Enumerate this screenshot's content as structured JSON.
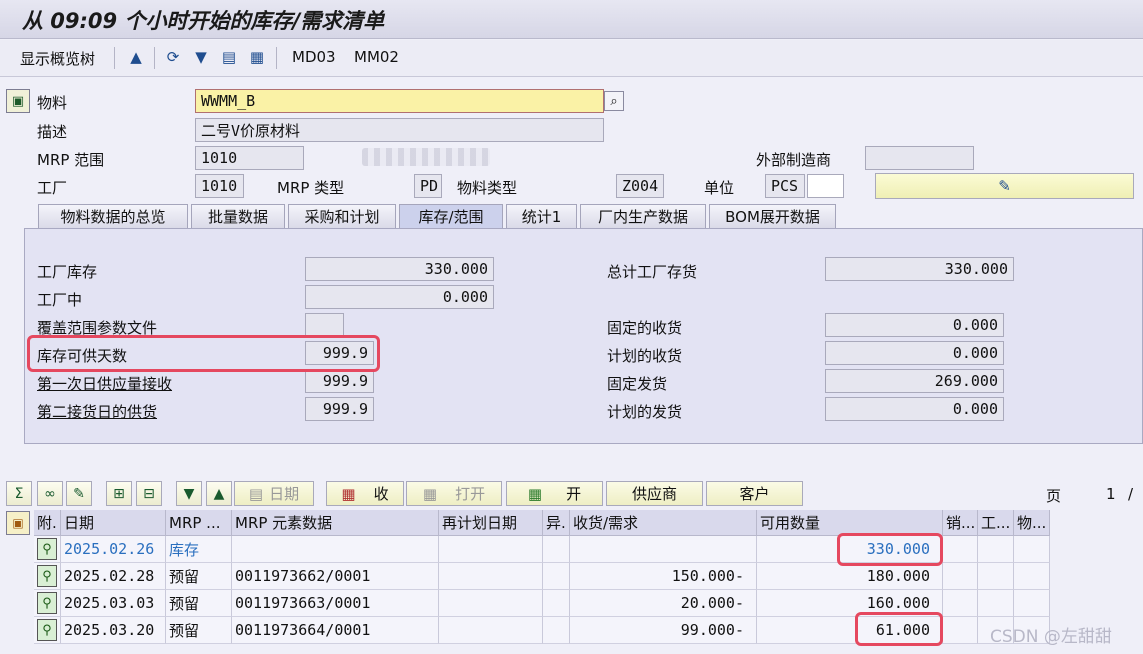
{
  "title": "从 09:09 个小时开始的库存/需求清单",
  "toolbar": {
    "show_overview_tree": "显示概览树",
    "md03": "MD03",
    "mm02": "MM02",
    "icons": [
      "overview-icon",
      "refresh-icon",
      "filter-icon",
      "save-variant-icon",
      "export-icon"
    ]
  },
  "header": {
    "material_label": "物料",
    "material_value": "WWMM_B",
    "description_label": "描述",
    "description_value": "二号V价原材料",
    "mrp_area_label": "MRP 范围",
    "mrp_area_value": "1010",
    "external_vendor_label": "外部制造商",
    "external_vendor_value": "",
    "plant_label": "工厂",
    "plant_value": "1010",
    "mrp_type_label": "MRP 类型",
    "mrp_type_value": "PD",
    "material_type_label": "物料类型",
    "material_type_value": "Z004",
    "unit_label": "单位",
    "unit_value": "PCS"
  },
  "tabs": [
    {
      "label": "物料数据的总览"
    },
    {
      "label": "批量数据"
    },
    {
      "label": "采购和计划"
    },
    {
      "label": "库存/范围",
      "active": true
    },
    {
      "label": "统计1"
    },
    {
      "label": "厂内生产数据"
    },
    {
      "label": "BOM展开数据"
    }
  ],
  "stock_panel": {
    "left": [
      {
        "label": "工厂库存",
        "value": "330.000"
      },
      {
        "label": "工厂中",
        "value": "0.000"
      },
      {
        "label": "覆盖范围参数文件",
        "value": ""
      },
      {
        "label": "库存可供天数",
        "value": "999.9"
      },
      {
        "label": "第一次日供应量接收",
        "value": "999.9"
      },
      {
        "label": "第二接货日的供货",
        "value": "999.9"
      }
    ],
    "right": [
      {
        "label": "总计工厂存货",
        "value": "330.000"
      },
      {
        "label": "固定的收货",
        "value": "0.000"
      },
      {
        "label": "计划的收货",
        "value": "0.000"
      },
      {
        "label": "固定发货",
        "value": "269.000"
      },
      {
        "label": "计划的发货",
        "value": "0.000"
      }
    ]
  },
  "grid_toolbar": {
    "date_label": "日期",
    "receive_label": "收",
    "open_label": "打开",
    "open2_label": "开",
    "supplier_label": "供应商",
    "customer_label": "客户",
    "page_label": "页",
    "page_value": "1",
    "page_sep": "/"
  },
  "table": {
    "columns": [
      "附.",
      "日期",
      "MRP ...",
      "MRP 元素数据",
      "再计划日期",
      "异.",
      "收货/需求",
      "可用数量",
      "销...",
      "工...",
      "物..."
    ],
    "rows": [
      {
        "date": "2025.02.26",
        "mrp": "库存",
        "element": "",
        "reschedule": "",
        "exc": "",
        "receipt": "",
        "available": "330.000",
        "highlight": true
      },
      {
        "date": "2025.02.28",
        "mrp": "预留",
        "element": "0011973662/0001",
        "reschedule": "",
        "exc": "",
        "receipt": "150.000-",
        "available": "180.000"
      },
      {
        "date": "2025.03.03",
        "mrp": "预留",
        "element": "0011973663/0001",
        "reschedule": "",
        "exc": "",
        "receipt": "20.000-",
        "available": "160.000"
      },
      {
        "date": "2025.03.20",
        "mrp": "预留",
        "element": "0011973664/0001",
        "reschedule": "",
        "exc": "",
        "receipt": "99.000-",
        "available": "61.000"
      }
    ]
  },
  "watermark": "CSDN @左甜甜",
  "colors": {
    "highlight_box": "#e5485f",
    "stock_blue": "#2a6fbf",
    "material_field": "#faf2a6"
  }
}
